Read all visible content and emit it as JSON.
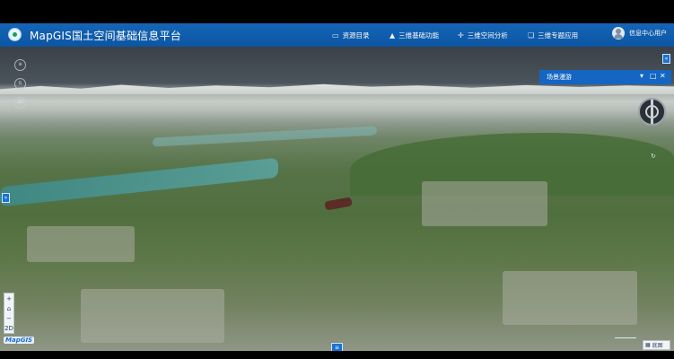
{
  "app": {
    "title": "MapGIS国土空间基础信息平台"
  },
  "nav": {
    "items": [
      {
        "icon": "map-book-icon",
        "label": "资源目录"
      },
      {
        "icon": "mountain-icon",
        "label": "三维基础功能"
      },
      {
        "icon": "crosshair-icon",
        "label": "三维空间分析"
      },
      {
        "icon": "layers-icon",
        "label": "三维专题应用"
      }
    ]
  },
  "user": {
    "name": "信息中心用户"
  },
  "panel": {
    "title": "场景漫游",
    "collapse_icon": "chevron-down-icon",
    "maximize_icon": "square-icon",
    "close_icon": "close-icon"
  },
  "left_tools": {
    "items": [
      "⊕",
      "⇅",
      "2D"
    ]
  },
  "edge_buttons": {
    "top_right": "«",
    "left": "»",
    "bottom_center": "≡"
  },
  "zoom": {
    "in": "+",
    "home": "⌂",
    "out": "−",
    "mode": "2D"
  },
  "branding": {
    "logo": "MapGIS"
  },
  "basemap": {
    "label": "底图"
  },
  "colors": {
    "header": "#0f5fb0",
    "accent": "#1b73d1"
  }
}
